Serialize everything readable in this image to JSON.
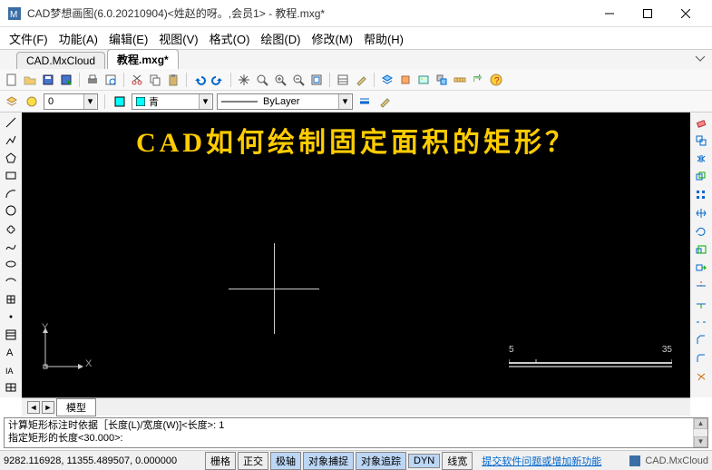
{
  "window": {
    "title": "CAD梦想画图(6.0.20210904)<姓赵的呀。,会员1> - 教程.mxg*"
  },
  "menu": {
    "file": "文件(F)",
    "function": "功能(A)",
    "edit": "编辑(E)",
    "view": "视图(V)",
    "format": "格式(O)",
    "draw": "绘图(D)",
    "modify": "修改(M)",
    "help": "帮助(H)"
  },
  "tabs": {
    "cloud": "CAD.MxCloud",
    "active": "教程.mxg*"
  },
  "layer": {
    "color_name": "青",
    "linetype": "ByLayer"
  },
  "canvas": {
    "headline": "CAD如何绘制固定面积的矩形？",
    "axis_y": "Y",
    "axis_x": "X",
    "ruler_left": "5",
    "ruler_right": "35"
  },
  "modeltab": {
    "label": "模型"
  },
  "command": {
    "line1": "计算矩形标注时依据［长度(L)/宽度(W)]<长度>: 1",
    "line2": "指定矩形的长度<30.000>:"
  },
  "status": {
    "coords": "9282.116928, 11355.489507, 0.000000",
    "grid": "栅格",
    "ortho": "正交",
    "polar": "极轴",
    "osnap": "对象捕捉",
    "otrack": "对象追踪",
    "dyn": "DYN",
    "lwt": "线宽",
    "feedback": "提交软件问题或增加新功能",
    "brand": "CAD.MxCloud"
  }
}
